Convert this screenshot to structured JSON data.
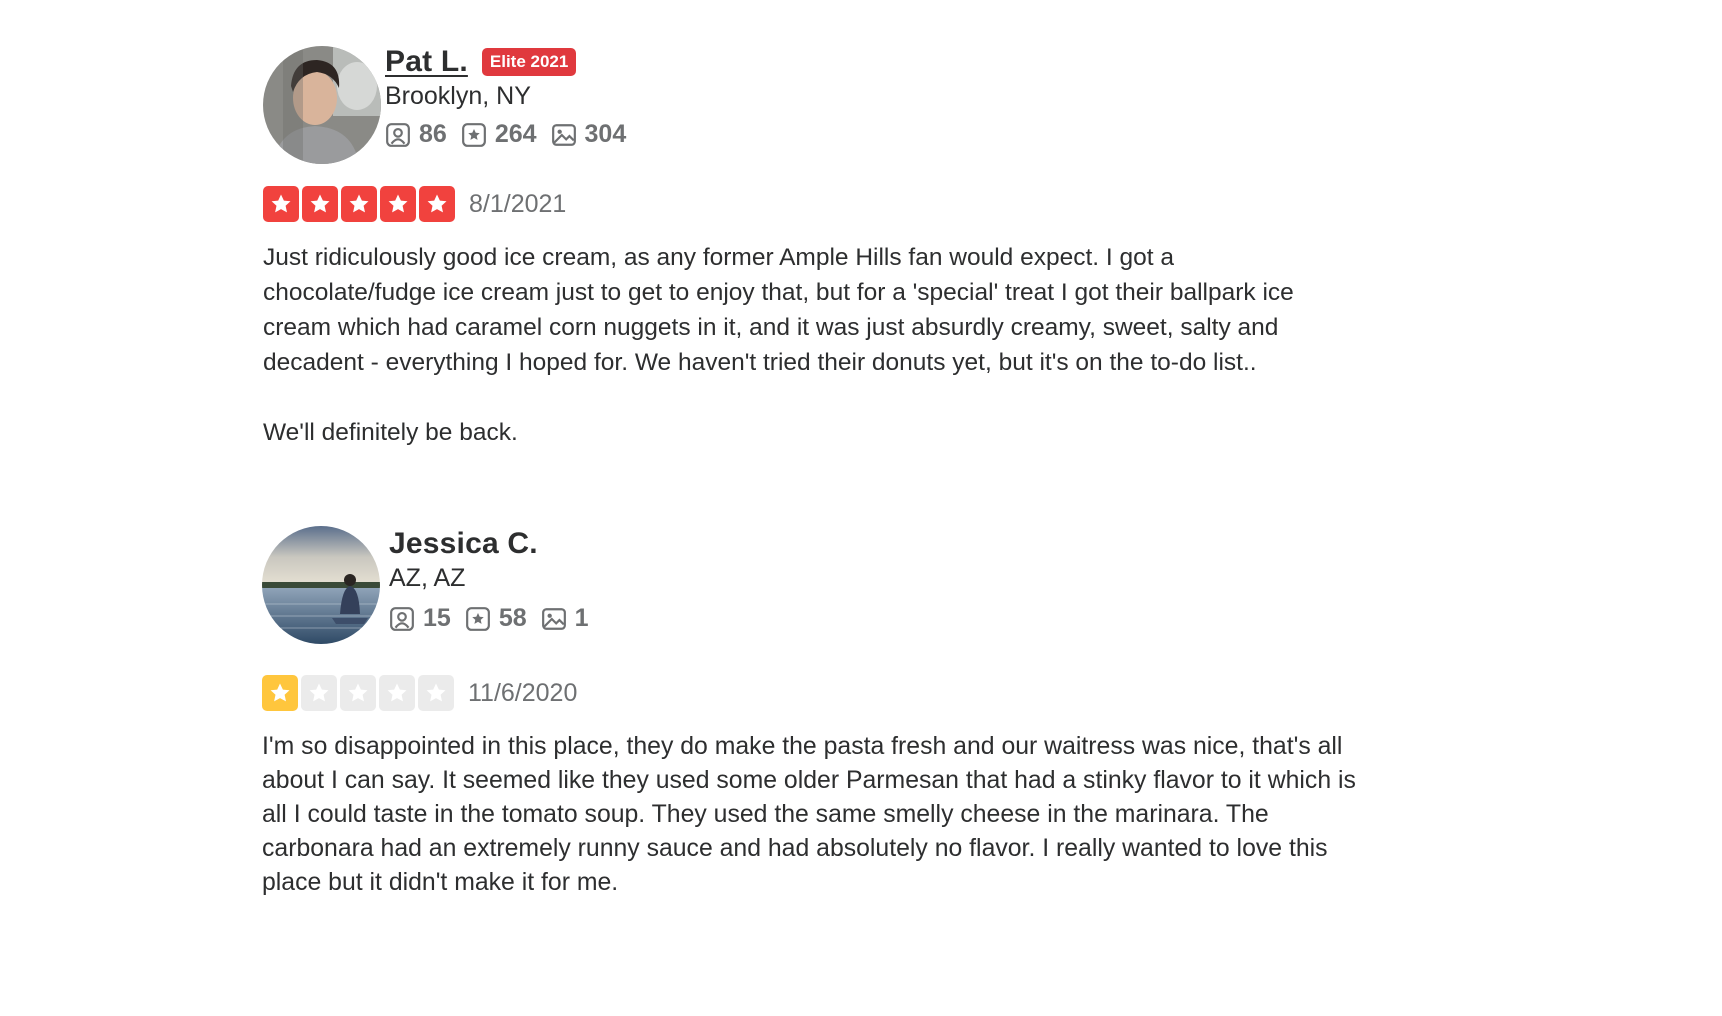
{
  "colors": {
    "elite_red": "#e0393e",
    "star_red": "#f1423e",
    "star_yellow": "#ffc63d",
    "star_empty": "#ebebeb",
    "muted_text": "#6e7072"
  },
  "reviews": [
    {
      "user": {
        "name": "Pat L.",
        "badge": "Elite 2021",
        "location": "Brooklyn, NY",
        "avatar_icon": "user-avatar-photo",
        "stats": [
          {
            "icon": "friends-icon",
            "value": "86"
          },
          {
            "icon": "reviews-star-icon",
            "value": "264"
          },
          {
            "icon": "photos-icon",
            "value": "304"
          }
        ]
      },
      "rating": 5,
      "rating_color": "red",
      "date": "8/1/2021",
      "text": "Just ridiculously good ice cream, as any former Ample Hills fan would expect.  I got a\nchocolate/fudge ice cream just to get to enjoy that, but for a 'special' treat I got their ballpark ice\ncream which had caramel corn nuggets in it, and it was just absurdly creamy, sweet, salty and\ndecadent - everything I hoped for.  We haven't tried their donuts yet, but it's on the to-do list..\n\nWe'll definitely be back."
    },
    {
      "user": {
        "name": "Jessica C.",
        "location": "AZ, AZ",
        "avatar_icon": "user-avatar-photo",
        "stats": [
          {
            "icon": "friends-icon",
            "value": "15"
          },
          {
            "icon": "reviews-star-icon",
            "value": "58"
          },
          {
            "icon": "photos-icon",
            "value": "1"
          }
        ]
      },
      "rating": 1,
      "rating_color": "yellow",
      "date": "11/6/2020",
      "text": "I'm so disappointed in this place, they do make the pasta fresh and our waitress was nice, that's all\nabout I can say. It seemed like they used some older Parmesan that had a stinky flavor to it which is\nall I could taste in the tomato soup. They used the same smelly cheese in the marinara. The\ncarbonara had an extremely runny sauce and had absolutely no flavor. I really wanted to love this\nplace but it didn't make it for me."
    }
  ]
}
